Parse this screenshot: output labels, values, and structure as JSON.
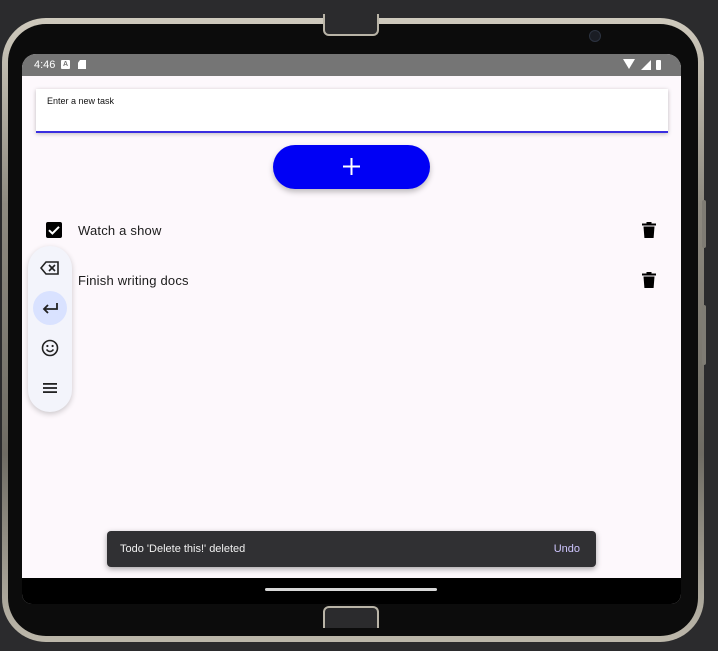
{
  "status_bar": {
    "time": "4:46",
    "left_icons": [
      "accessibility-a-icon",
      "sd-card-icon"
    ],
    "right_icons": [
      "wifi-icon",
      "signal-icon",
      "battery-icon"
    ]
  },
  "task_input": {
    "label": "Enter a new task",
    "value": ""
  },
  "add_button": {
    "icon": "plus-icon",
    "color": "#0000f5"
  },
  "todos": [
    {
      "label": "Watch a show",
      "checked": true
    },
    {
      "label": "Finish writing docs",
      "checked": false
    }
  ],
  "keyboard_toolbar": {
    "buttons": [
      "backspace-icon",
      "enter-icon",
      "emoji-icon",
      "menu-icon"
    ]
  },
  "snackbar": {
    "message": "Todo 'Delete this!' deleted",
    "action": "Undo"
  },
  "colors": {
    "accent": "#0000f5",
    "background": "#fdf8fc",
    "snackbar_action": "#cfc6ff"
  }
}
